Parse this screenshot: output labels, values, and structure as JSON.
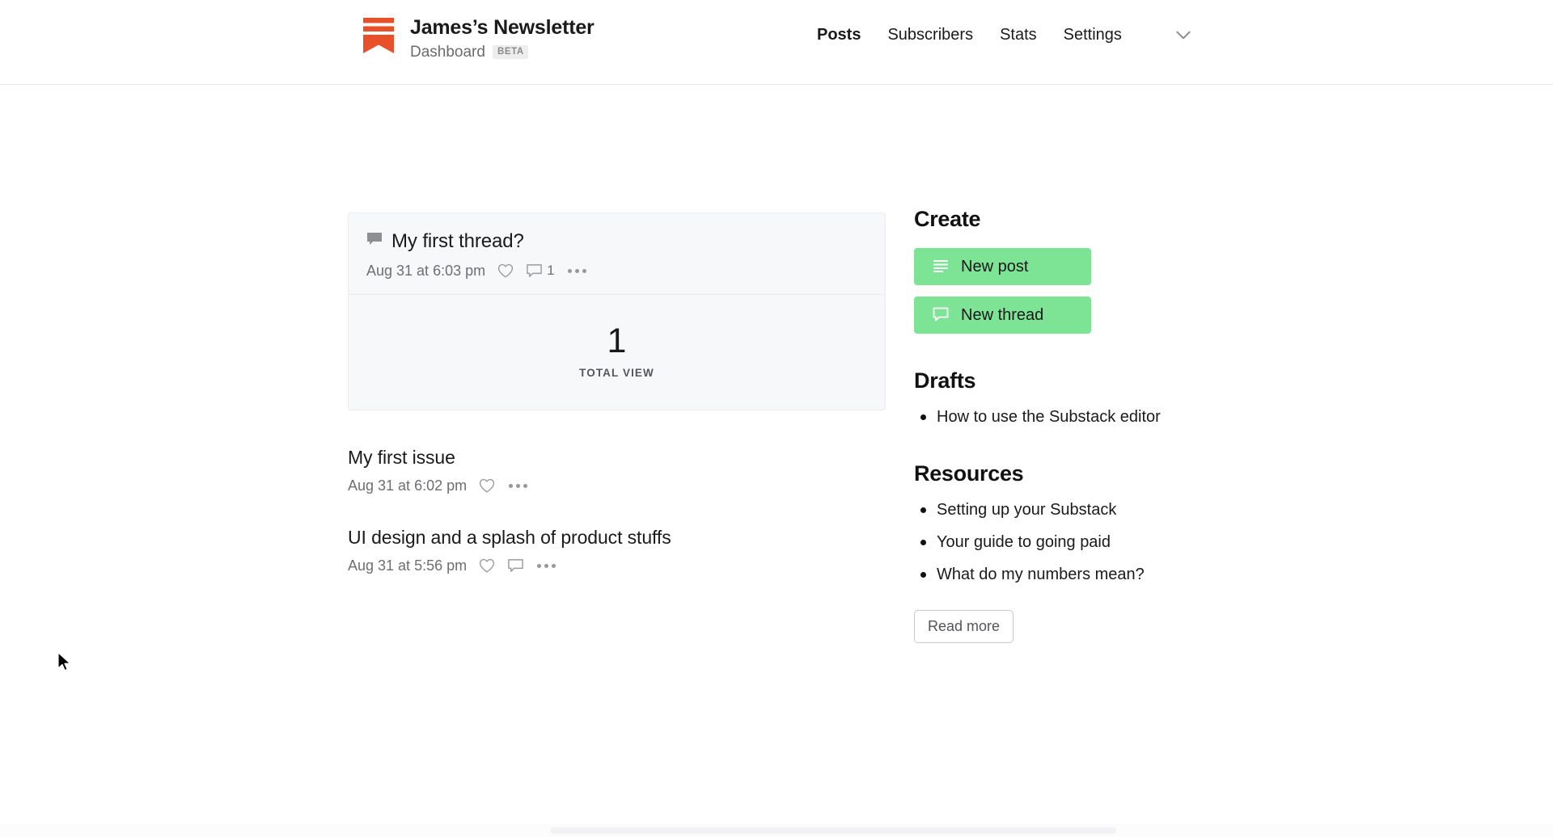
{
  "header": {
    "brand_title": "James’s Newsletter",
    "brand_subtitle": "Dashboard",
    "beta_badge": "BETA",
    "nav": [
      {
        "label": "Posts",
        "active": true
      },
      {
        "label": "Subscribers",
        "active": false
      },
      {
        "label": "Stats",
        "active": false
      },
      {
        "label": "Settings",
        "active": false
      }
    ]
  },
  "thread_card": {
    "title": "My first thread?",
    "date": "Aug 31 at 6:03 pm",
    "comment_count": "1",
    "stat_value": "1",
    "stat_label": "TOTAL VIEW"
  },
  "posts": [
    {
      "title": "My first issue",
      "date": "Aug 31 at 6:02 pm",
      "has_comment_icon": false,
      "comment_count": ""
    },
    {
      "title": "UI design and a splash of product stuffs",
      "date": "Aug 31 at 5:56 pm",
      "has_comment_icon": true,
      "comment_count": ""
    }
  ],
  "sidebar": {
    "create_heading": "Create",
    "new_post_label": "New post",
    "new_thread_label": "New thread",
    "drafts_heading": "Drafts",
    "drafts": [
      "How to use the Substack editor"
    ],
    "resources_heading": "Resources",
    "resources": [
      "Setting up your Substack",
      "Your guide to going paid",
      "What do my numbers mean?"
    ],
    "read_more_label": "Read more"
  },
  "colors": {
    "brand_orange": "#e8502a",
    "accent_green": "#7ee495",
    "card_bg": "#f7f8fa",
    "muted_text": "#6e6e73"
  }
}
